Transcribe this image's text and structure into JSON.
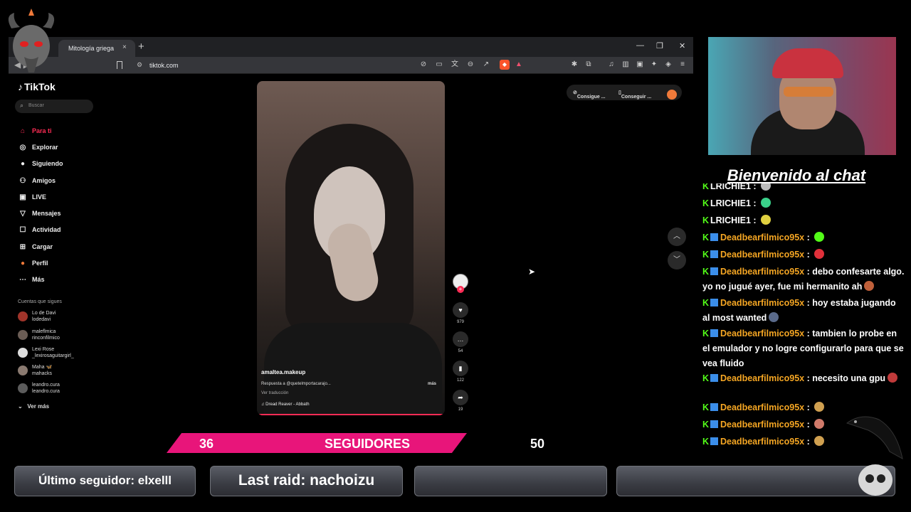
{
  "browser": {
    "tab_title": "Mitología griega",
    "tab_close": "×",
    "new_tab": "+",
    "url": "tiktok.com",
    "win_minimize": "—",
    "win_restore": "❐",
    "win_close": "✕"
  },
  "tiktok": {
    "logo": "TikTok",
    "search_placeholder": "Buscar",
    "nav": [
      {
        "label": "Para ti",
        "icon": "home-icon"
      },
      {
        "label": "Explorar",
        "icon": "compass-icon"
      },
      {
        "label": "Siguiendo",
        "icon": "following-icon"
      },
      {
        "label": "Amigos",
        "icon": "friends-icon"
      },
      {
        "label": "LIVE",
        "icon": "live-icon"
      },
      {
        "label": "Mensajes",
        "icon": "messages-icon"
      },
      {
        "label": "Actividad",
        "icon": "activity-icon"
      },
      {
        "label": "Cargar",
        "icon": "upload-icon"
      },
      {
        "label": "Perfil",
        "icon": "profile-icon"
      },
      {
        "label": "Más",
        "icon": "more-icon"
      }
    ],
    "following_title": "Cuentas que sigues",
    "following": [
      {
        "name": "Lo de Davi",
        "handle": "lodedavi"
      },
      {
        "name": "maleflmica",
        "handle": "rinconfilmico"
      },
      {
        "name": "Lexi Rose",
        "handle": "_lexirosaguitargirl_"
      },
      {
        "name": "Maha 🦋",
        "handle": "mahacks"
      },
      {
        "name": "leandro.cura",
        "handle": "leandro.cura"
      }
    ],
    "see_more": "Ver más",
    "video": {
      "username": "amaltea.makeup",
      "description": "Respuesta a @quetelmportacarajo...",
      "more": "más",
      "translate": "Ver traducción",
      "sound": "♫  Dread Reaver - Abbath"
    },
    "actions": {
      "likes": "979",
      "comments": "54",
      "saves": "122",
      "shares": "19"
    },
    "pill_left": "Consigue ...",
    "pill_right": "Conseguir ..."
  },
  "stream": {
    "welcome": "Bienvenido al chat",
    "chat": [
      {
        "user": "LRICHIE1",
        "text": " : ",
        "user_color": "green",
        "badge": "k",
        "emote": "#bbbbbb"
      },
      {
        "user": "LRICHIE1",
        "text": " : ",
        "user_color": "green",
        "badge": "k",
        "emote": "#3ad18a"
      },
      {
        "user": "LRICHIE1",
        "text": " : ",
        "user_color": "green",
        "badge": "k",
        "emote": "#e0d040"
      },
      {
        "user": "Deadbearfilmico95x",
        "text": " : ",
        "user_color": "orange",
        "badge": "kh",
        "emote": "#53fc18"
      },
      {
        "user": "Deadbearfilmico95x",
        "text": " : ",
        "user_color": "orange",
        "badge": "kh",
        "emote": "#e0303a"
      },
      {
        "user": "Deadbearfilmico95x",
        "text": " : debo confesarte algo. yo no jugué ayer, fue mi hermanito ah",
        "user_color": "orange",
        "badge": "kh",
        "emote": "#c0603a"
      },
      {
        "user": "Deadbearfilmico95x",
        "text": " : hoy estaba jugando al most wanted",
        "user_color": "orange",
        "badge": "kh",
        "emote": "#5a6a8a"
      },
      {
        "user": "Deadbearfilmico95x",
        "text": " : tambien lo probe en el emulador y no logre configurarlo para que se vea fluido",
        "user_color": "orange",
        "badge": "kh",
        "emote": ""
      },
      {
        "user": "Deadbearfilmico95x",
        "text": " : necesito una gpu",
        "user_color": "orange",
        "badge": "kh",
        "emote": "#c03a3a"
      },
      {
        "user": "Deadbearfilmico95x",
        "text": " : ",
        "user_color": "orange",
        "badge": "kh",
        "emote": "#d0a050"
      },
      {
        "user": "Deadbearfilmico95x",
        "text": " : ",
        "user_color": "orange",
        "badge": "kh",
        "emote": "#d07a6a"
      },
      {
        "user": "Deadbearfilmico95x",
        "text": " : ",
        "user_color": "orange",
        "badge": "kh",
        "emote": "#d0a050"
      }
    ],
    "followers_count": "36",
    "followers_label": "SEGUIDORES",
    "followers_goal": "50",
    "followers_progress": 0.72,
    "panels": {
      "last_follower": "Último seguidor: elxelll",
      "last_raid": "Last raid: nachoizu",
      "panel3": "",
      "panel4": ""
    }
  },
  "colors": {
    "tiktok_red": "#fe2c55",
    "follower_pink": "#e8157a",
    "kick_green": "#53fc18",
    "username_orange": "#f5a623"
  }
}
